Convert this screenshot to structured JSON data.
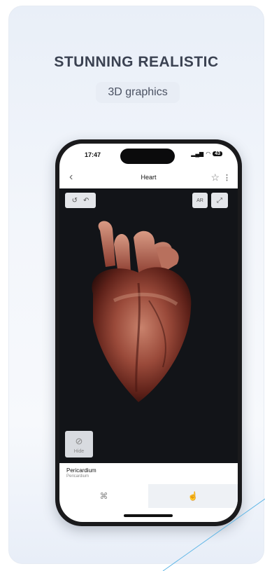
{
  "promo": {
    "headline": "STUNNING REALISTIC",
    "subheadline": "3D graphics"
  },
  "phone": {
    "status_time": "17:47",
    "status_icons": "signal-wifi",
    "battery": "43",
    "nav": {
      "back_icon": "chevron-left-icon",
      "title": "Heart",
      "favorite_icon": "star-outline-icon",
      "more_icon": "more-vertical-icon"
    },
    "viewer": {
      "buttons_left": [
        "undo-icon",
        "redo-icon"
      ],
      "ar_label": "AR",
      "expand_icon": "expand-icon",
      "hide_label": "Hide",
      "model": "heart-3d-model"
    },
    "selection": {
      "title": "Pericardium",
      "subtitle": "Pericardium"
    },
    "tabs": [
      {
        "icon": "layers-icon",
        "active": false
      },
      {
        "icon": "hand-pointer-icon",
        "active": true
      }
    ]
  },
  "colors": {
    "viewport_bg": "#121418",
    "headline": "#3b4252",
    "accent_line": "#5fb6e6"
  }
}
